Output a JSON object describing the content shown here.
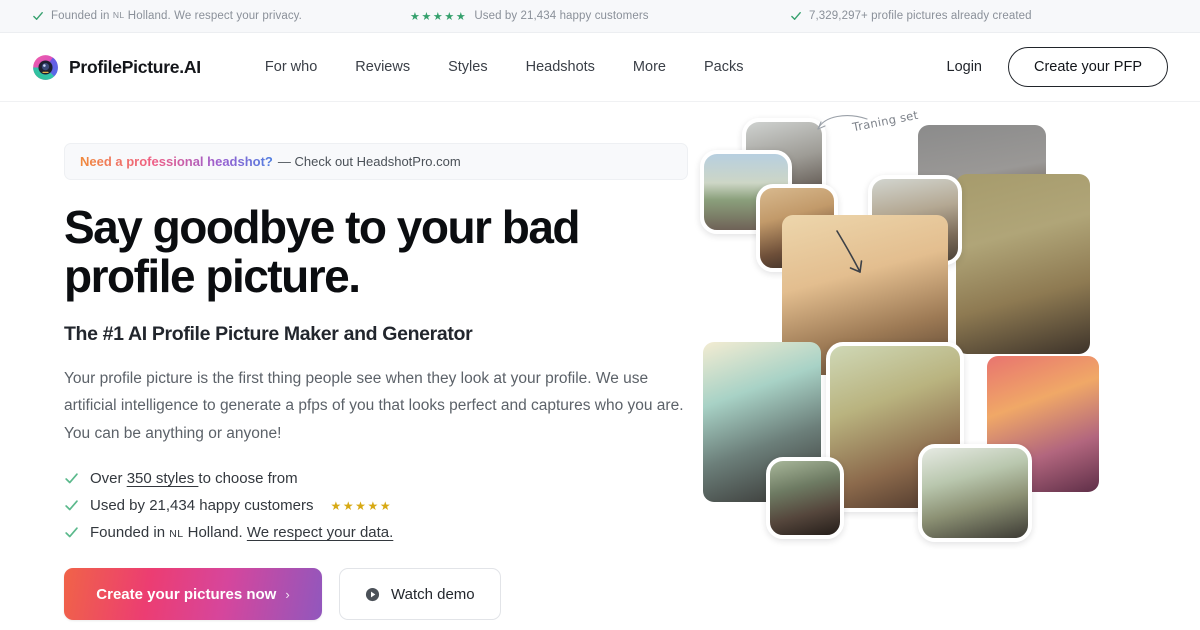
{
  "topbar": {
    "items": [
      {
        "icon": "check-icon",
        "text_pre": "Founded in ",
        "small": "NL",
        "text_post": " Holland. We respect your privacy."
      },
      {
        "icon": "star-rating-icon",
        "stars": "★★★★★",
        "text": "Used by 21,434 happy customers"
      },
      {
        "icon": "check-icon",
        "text": "7,329,297+ profile pictures already created"
      }
    ]
  },
  "header": {
    "logo_icon": "profilepicture-ai-logo-icon",
    "brand": "ProfilePicture.AI",
    "nav": [
      {
        "label": "For who"
      },
      {
        "label": "Reviews"
      },
      {
        "label": "Styles"
      },
      {
        "label": "Headshots"
      },
      {
        "label": "More"
      },
      {
        "label": "Packs"
      }
    ],
    "login_label": "Login",
    "cta_label": "Create your PFP"
  },
  "hero": {
    "promo": {
      "highlight": "Need a professional headshot?",
      "rest": "— Check out HeadshotPro.com"
    },
    "headline": "Say goodbye to your bad profile picture.",
    "subhead": "The #1 AI Profile Picture Maker and Generator",
    "lede": "Your profile picture is the first thing people see when they look at your profile. We use artificial intelligence to generate a pfps of you that looks perfect and captures who you are. You can be anything or anyone!",
    "bullets": [
      {
        "pre": "Over ",
        "link": "350 styles ",
        "post": "to choose from",
        "stars": ""
      },
      {
        "pre": "Used by 21,434 happy customers",
        "link": "",
        "post": "",
        "stars": "★★★★★"
      },
      {
        "pre": "Founded in ",
        "small": "NL",
        "mid": " Holland. ",
        "link": "We respect your data.",
        "post": "",
        "stars": ""
      }
    ],
    "cta_primary": "Create your pictures now",
    "cta_primary_chevron": "›",
    "cta_secondary": "Watch demo",
    "annotation": "Traning set"
  },
  "colors": {
    "accent_gradient_start": "#f06348",
    "accent_gradient_mid": "#ec3d72",
    "accent_gradient_end": "#9157bd",
    "check_green": "#37a16f",
    "star_green": "#34a06c",
    "star_gold": "#d7a914",
    "text_dark": "#0b0d10",
    "text_body": "#5c6269",
    "topbar_bg": "#f7f8fa"
  }
}
